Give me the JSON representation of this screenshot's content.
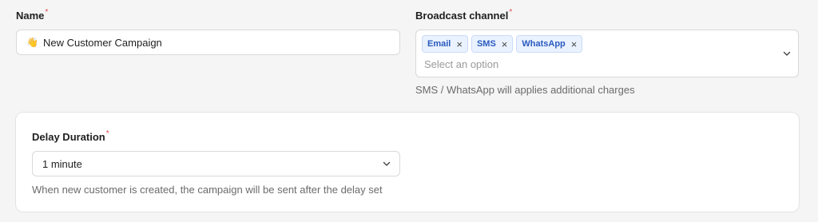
{
  "name_field": {
    "label": "Name",
    "required_mark": "*",
    "emoji": "👋",
    "value": "New Customer Campaign"
  },
  "broadcast": {
    "label": "Broadcast channel",
    "required_mark": "*",
    "tags": [
      {
        "label": "Email",
        "remove": "×"
      },
      {
        "label": "SMS",
        "remove": "×"
      },
      {
        "label": "WhatsApp",
        "remove": "×"
      }
    ],
    "placeholder": "Select an option",
    "helper": "SMS / WhatsApp will applies additional charges",
    "chevron_icon": "chevron-down-icon"
  },
  "delay": {
    "label": "Delay Duration",
    "required_mark": "*",
    "selected": "1 minute",
    "helper": "When new customer is created, the campaign will be sent after the delay set",
    "chevron_icon": "chevron-down-icon"
  }
}
